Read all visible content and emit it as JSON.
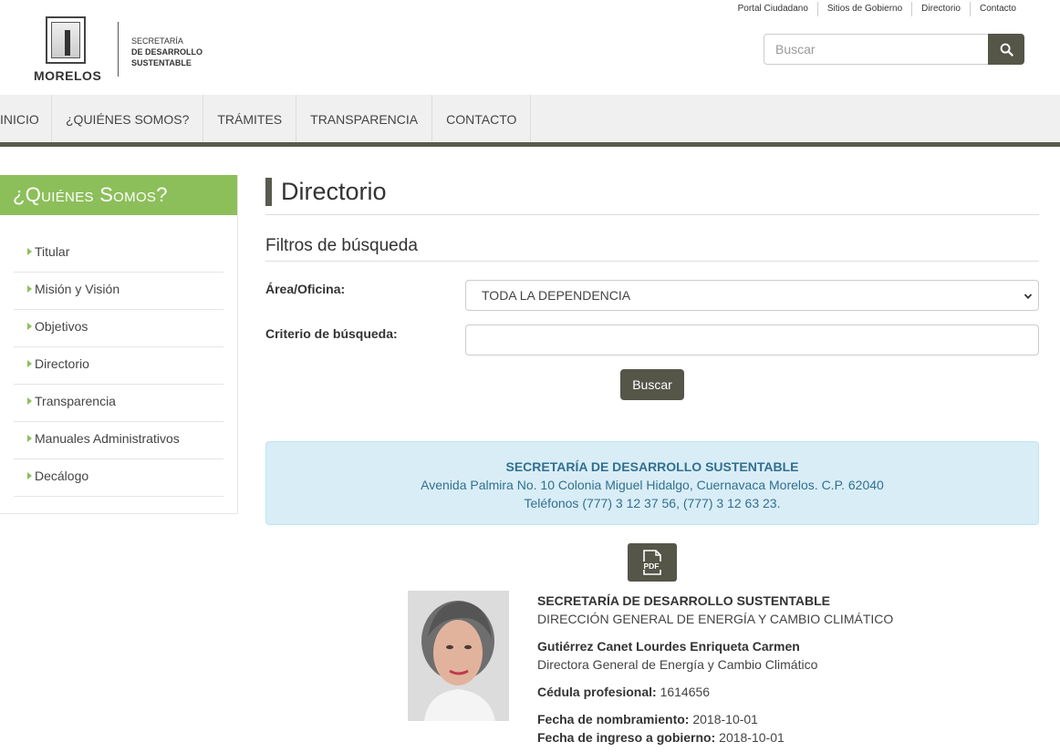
{
  "header": {
    "top_links": [
      "Portal Ciudadano",
      "Sitios de Gobierno",
      "Directorio",
      "Contacto"
    ],
    "logo_state": "MORELOS",
    "logo_sec_line1": "SECRETARÍA",
    "logo_sec_line2": "DE DESARROLLO",
    "logo_sec_line3": "SUSTENTABLE",
    "search_placeholder": "Buscar"
  },
  "nav": [
    "INICIO",
    "¿QUIÉNES SOMOS?",
    "TRÁMITES",
    "TRANSPARENCIA",
    "CONTACTO"
  ],
  "sidebar": {
    "title": "¿Quiénes Somos?",
    "items": [
      "Titular",
      "Misión y Visión",
      "Objetivos",
      "Directorio",
      "Transparencia",
      "Manuales Administrativos",
      "Decálogo"
    ]
  },
  "main": {
    "title": "Directorio",
    "filters_title": "Filtros de búsqueda",
    "area_label": "Área/Oficina:",
    "area_value": "TODA LA DEPENDENCIA",
    "criterio_label": "Criterio de búsqueda:",
    "criterio_value": "",
    "search_button": "Buscar",
    "info": {
      "title": "SECRETARÍA DE DESARROLLO SUSTENTABLE",
      "address": "Avenida Palmira No. 10 Colonia Miguel Hidalgo, Cuernavaca Morelos. C.P. 62040",
      "phones": "Teléfonos (777) 3 12 37 56, (777) 3 12 63 23."
    },
    "pdf_label": "PDF",
    "entry": {
      "dependency": "SECRETARÍA DE DESARROLLO SUSTENTABLE",
      "area": "DIRECCIÓN GENERAL DE ENERGÍA Y CAMBIO CLIMÁTICO",
      "name": "Gutiérrez Canet Lourdes Enriqueta Carmen",
      "position": "Directora General de Energía y Cambio Climático",
      "cedula_label": "Cédula profesional:",
      "cedula_value": "1614656",
      "fecha_nom_label": "Fecha de nombramiento:",
      "fecha_nom_value": "2018-10-01",
      "fecha_ing_label": "Fecha de ingreso a gobierno:",
      "fecha_ing_value": "2018-10-01"
    }
  },
  "colors": {
    "accent_green": "#8cbf5a",
    "dark_olive": "#555548",
    "info_bg": "#d9edf7",
    "info_text": "#31708f"
  }
}
